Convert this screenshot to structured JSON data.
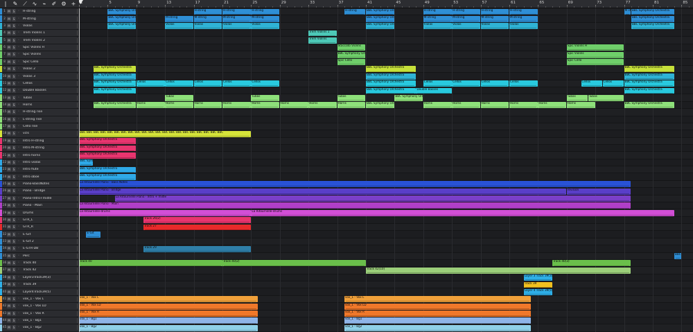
{
  "ruler": {
    "bars": [
      "1",
      "5",
      "9",
      "13",
      "17",
      "21",
      "25",
      "29",
      "33",
      "37",
      "41",
      "45",
      "49",
      "53",
      "57",
      "61",
      "65",
      "69",
      "73",
      "77",
      "81",
      "85"
    ]
  },
  "toolbar": {
    "tools": [
      {
        "name": "cursor-tool-icon",
        "glyph": "|"
      },
      {
        "name": "pencil-tool-icon",
        "glyph": "✎"
      },
      {
        "name": "automation-tool-icon",
        "glyph": "⟋"
      },
      {
        "name": "curve-tool-icon",
        "glyph": "∿"
      },
      {
        "name": "paint-tool-icon",
        "glyph": "⌁"
      },
      {
        "name": "brush-tool-icon",
        "glyph": "✐"
      },
      {
        "name": "settings-icon",
        "glyph": "⚙"
      },
      {
        "name": "add-track-icon",
        "glyph": "+"
      }
    ]
  },
  "track_buttons": {
    "mute": "M",
    "solo": "S",
    "monitor": "◦"
  },
  "tracks": [
    {
      "name": "H-string",
      "color": "#2f8fd6"
    },
    {
      "name": "M-string",
      "color": "#2f8fd6"
    },
    {
      "name": "Violas",
      "color": "#2fb3d6"
    },
    {
      "name": "Trem Violins 1",
      "color": "#4ec9b8"
    },
    {
      "name": "Trem Violins 2",
      "color": "#4ec9b8"
    },
    {
      "name": "Spic Violins H",
      "color": "#6fcf6a"
    },
    {
      "name": "Spic Violins",
      "color": "#6fcf6a"
    },
    {
      "name": "Spic Cello",
      "color": "#6fcf6a"
    },
    {
      "name": "Violas 2",
      "color": "#c6e03a"
    },
    {
      "name": "Violas 3",
      "color": "#2fb3d6"
    },
    {
      "name": "Cellos",
      "color": "#29c9de"
    },
    {
      "name": "Double Basses",
      "color": "#29c9de"
    },
    {
      "name": "Tubas",
      "color": "#8ee07a"
    },
    {
      "name": "Horns",
      "color": "#8ee07a"
    },
    {
      "name": "H-string rise",
      "color": "#8ee07a"
    },
    {
      "name": "L-string rise",
      "color": "#8ee07a"
    },
    {
      "name": "Cello rise",
      "color": "#8ee07a"
    },
    {
      "name": "vcls",
      "color": "#d6e43a"
    },
    {
      "name": "Intro H-string",
      "color": "#e8356f"
    },
    {
      "name": "Intro M-string",
      "color": "#e8356f"
    },
    {
      "name": "Intro horns",
      "color": "#e8356f"
    },
    {
      "name": "Intro violas",
      "color": "#2fa9e8"
    },
    {
      "name": "Intro flute",
      "color": "#2fa9e8"
    },
    {
      "name": "Intro oboe",
      "color": "#2fa9e8"
    },
    {
      "name": "Piano-BassNotes",
      "color": "#2952d6"
    },
    {
      "name": "Piano - Bridge",
      "color": "#5a3fc8"
    },
    {
      "name": "Piano-Intro+midle",
      "color": "#7b3fc8"
    },
    {
      "name": "Piano - Main",
      "color": "#b03fc8"
    },
    {
      "name": "Drums",
      "color": "#d24fd6"
    },
    {
      "name": "GTR_L",
      "color": "#e8356f"
    },
    {
      "name": "GTR_R",
      "color": "#e82a2a"
    },
    {
      "name": "E-Git",
      "color": "#2f8fd6"
    },
    {
      "name": "E-Git 2",
      "color": "#2f8fd6"
    },
    {
      "name": "E-GTR-DB",
      "color": "#2f8fd6"
    },
    {
      "name": "Perc",
      "color": "#2f8fd6"
    },
    {
      "name": "Track 40",
      "color": "#6abf4b"
    },
    {
      "name": "Track 42",
      "color": "#9ccf7a"
    },
    {
      "name": "Layer3Track39(3)",
      "color": "#2fb0e8"
    },
    {
      "name": "Track 39",
      "color": "#2fb0e8"
    },
    {
      "name": "Layer4Track39(5)",
      "color": "#2fb0e8"
    },
    {
      "name": "vox_1 - Vox L",
      "color": "#f0a03a"
    },
    {
      "name": "vox_1 - Vox LD",
      "color": "#f0782a"
    },
    {
      "name": "vox_1 - Vox R",
      "color": "#f0782a"
    },
    {
      "name": "vox_1 - Bg1",
      "color": "#8fb4e8"
    },
    {
      "name": "vox_1 - Bg2",
      "color": "#8fd0e8"
    }
  ],
  "clips": [
    {
      "t": 0,
      "s": 5,
      "e": 9,
      "label": "BBC Symphony Orchestra",
      "color": "#2f8fd6"
    },
    {
      "t": 0,
      "s": 17,
      "e": 21,
      "label": "H-string",
      "color": "#2f8fd6"
    },
    {
      "t": 0,
      "s": 21,
      "e": 25,
      "label": "H-string",
      "color": "#2f8fd6"
    },
    {
      "t": 0,
      "s": 25,
      "e": 29,
      "label": "H-string",
      "color": "#2f8fd6"
    },
    {
      "t": 0,
      "s": 38,
      "e": 41,
      "label": "H-string",
      "color": "#2f8fd6"
    },
    {
      "t": 0,
      "s": 41,
      "e": 45,
      "label": "BBC Symphony Orchestra",
      "color": "#2f8fd6"
    },
    {
      "t": 0,
      "s": 49,
      "e": 53,
      "label": "H-string",
      "color": "#2f8fd6"
    },
    {
      "t": 0,
      "s": 53,
      "e": 57,
      "label": "H-string",
      "color": "#2f8fd6"
    },
    {
      "t": 0,
      "s": 57,
      "e": 61,
      "label": "H-string",
      "color": "#2f8fd6"
    },
    {
      "t": 0,
      "s": 61,
      "e": 65,
      "label": "H-string",
      "color": "#2f8fd6"
    },
    {
      "t": 0,
      "s": 77,
      "e": 78,
      "label": "M str",
      "color": "#2f8fd6"
    },
    {
      "t": 0,
      "s": 78,
      "e": 84,
      "label": "BBC Symphony Orchestra",
      "color": "#2f8fd6"
    },
    {
      "t": 1,
      "s": 5,
      "e": 9,
      "label": "BBC Symphony Orchestra",
      "color": "#2f8fd6"
    },
    {
      "t": 1,
      "s": 13,
      "e": 17,
      "label": "M-string",
      "color": "#2f8fd6"
    },
    {
      "t": 1,
      "s": 17,
      "e": 21,
      "label": "M-string",
      "color": "#2f8fd6"
    },
    {
      "t": 1,
      "s": 21,
      "e": 25,
      "label": "M-string",
      "color": "#2f8fd6"
    },
    {
      "t": 1,
      "s": 25,
      "e": 29,
      "label": "M-string",
      "color": "#2f8fd6"
    },
    {
      "t": 1,
      "s": 41,
      "e": 45,
      "label": "BBC Symphony Orchestra",
      "color": "#2f8fd6"
    },
    {
      "t": 1,
      "s": 49,
      "e": 53,
      "label": "M-string",
      "color": "#2f8fd6"
    },
    {
      "t": 1,
      "s": 53,
      "e": 57,
      "label": "M-string",
      "color": "#2f8fd6"
    },
    {
      "t": 1,
      "s": 57,
      "e": 61,
      "label": "M-string",
      "color": "#2f8fd6"
    },
    {
      "t": 1,
      "s": 61,
      "e": 65,
      "label": "M-string",
      "color": "#2f8fd6"
    },
    {
      "t": 1,
      "s": 78,
      "e": 84,
      "label": "BBC Symphony Orchestra",
      "color": "#2f8fd6"
    },
    {
      "t": 2,
      "s": 5,
      "e": 9,
      "label": "BBC Symphony Orchestra",
      "color": "#2fb3d6"
    },
    {
      "t": 2,
      "s": 13,
      "e": 17,
      "label": "Violas",
      "color": "#2fb3d6"
    },
    {
      "t": 2,
      "s": 17,
      "e": 21,
      "label": "Violas",
      "color": "#2fb3d6"
    },
    {
      "t": 2,
      "s": 21,
      "e": 25,
      "label": "Violas",
      "color": "#2fb3d6"
    },
    {
      "t": 2,
      "s": 25,
      "e": 29,
      "label": "Violas",
      "color": "#2fb3d6"
    },
    {
      "t": 2,
      "s": 41,
      "e": 45,
      "label": "BBC Symphony Orchestra",
      "color": "#2fb3d6"
    },
    {
      "t": 2,
      "s": 49,
      "e": 53,
      "label": "Violas",
      "color": "#2fb3d6"
    },
    {
      "t": 2,
      "s": 53,
      "e": 57,
      "label": "Violas",
      "color": "#2fb3d6"
    },
    {
      "t": 2,
      "s": 57,
      "e": 61,
      "label": "Violas",
      "color": "#2fb3d6"
    },
    {
      "t": 2,
      "s": 61,
      "e": 65,
      "label": "Violas",
      "color": "#2fb3d6"
    },
    {
      "t": 2,
      "s": 78,
      "e": 84,
      "label": "BBC Symphony Orchestra",
      "color": "#2fb3d6"
    },
    {
      "t": 3,
      "s": 33,
      "e": 37,
      "label": "Trem Violins 1",
      "color": "#4ec9b8"
    },
    {
      "t": 4,
      "s": 33,
      "e": 37,
      "label": "Trem Violins",
      "color": "#4ec9b8"
    },
    {
      "t": 5,
      "s": 37,
      "e": 41,
      "label": "Staccato Violins",
      "color": "#6fcf6a"
    },
    {
      "t": 5,
      "s": 69,
      "e": 77,
      "label": "Spic Violins H",
      "color": "#6fcf6a"
    },
    {
      "t": 6,
      "s": 37,
      "e": 41,
      "label": "BBC Symphony Orche",
      "color": "#6fcf6a"
    },
    {
      "t": 6,
      "s": 69,
      "e": 77,
      "label": "Spic Violins",
      "color": "#6fcf6a"
    },
    {
      "t": 7,
      "s": 37,
      "e": 41,
      "label": "Spic Cello",
      "color": "#6fcf6a"
    },
    {
      "t": 7,
      "s": 69,
      "e": 77,
      "label": "Spic Cello",
      "color": "#6fcf6a"
    },
    {
      "t": 8,
      "s": 3,
      "e": 9,
      "label": "BBC Symphony Orchestra",
      "color": "#c6e03a"
    },
    {
      "t": 8,
      "s": 41,
      "e": 48,
      "label": "BBC Symphony Orchestra",
      "color": "#c6e03a"
    },
    {
      "t": 8,
      "s": 77,
      "e": 84,
      "label": "BBC Symphony Orchestra",
      "color": "#c6e03a"
    },
    {
      "t": 9,
      "s": 3,
      "e": 9,
      "label": "BBC Symphony Orchestra",
      "color": "#2fb3d6"
    },
    {
      "t": 9,
      "s": 41,
      "e": 48,
      "label": "BBC Symphony Orchestra",
      "color": "#2fb3d6"
    },
    {
      "t": 9,
      "s": 77,
      "e": 84,
      "label": "BBC Symphony Orchestra",
      "color": "#2fb3d6"
    },
    {
      "t": 10,
      "s": 3,
      "e": 9,
      "label": "BBC Symphony Orchestra",
      "color": "#29c9de"
    },
    {
      "t": 10,
      "s": 9,
      "e": 13,
      "label": "Cellos",
      "color": "#29c9de"
    },
    {
      "t": 10,
      "s": 13,
      "e": 17,
      "label": "Cellos",
      "color": "#29c9de"
    },
    {
      "t": 10,
      "s": 17,
      "e": 21,
      "label": "Cellos",
      "color": "#29c9de"
    },
    {
      "t": 10,
      "s": 21,
      "e": 25,
      "label": "Cellos",
      "color": "#29c9de"
    },
    {
      "t": 10,
      "s": 25,
      "e": 29,
      "label": "Cellos",
      "color": "#29c9de"
    },
    {
      "t": 10,
      "s": 41,
      "e": 48,
      "label": "BBC Symphony Orchestra",
      "color": "#29c9de"
    },
    {
      "t": 10,
      "s": 49,
      "e": 53,
      "label": "Cellos",
      "color": "#29c9de"
    },
    {
      "t": 10,
      "s": 53,
      "e": 57,
      "label": "Cellos",
      "color": "#29c9de"
    },
    {
      "t": 10,
      "s": 57,
      "e": 61,
      "label": "Cellos",
      "color": "#29c9de"
    },
    {
      "t": 10,
      "s": 61,
      "e": 65,
      "label": "Cellos",
      "color": "#29c9de"
    },
    {
      "t": 10,
      "s": 71,
      "e": 74,
      "label": "Cellos",
      "color": "#29c9de"
    },
    {
      "t": 10,
      "s": 74,
      "e": 77,
      "label": "Cellos",
      "color": "#29c9de"
    },
    {
      "t": 10,
      "s": 77,
      "e": 84,
      "label": "BBC Symphony Orchestra",
      "color": "#29c9de"
    },
    {
      "t": 11,
      "s": 3,
      "e": 9,
      "label": "BBC Symphony Orchestra",
      "color": "#29c9de"
    },
    {
      "t": 11,
      "s": 41,
      "e": 48,
      "label": "BBC Symphony Orchestra",
      "color": "#29c9de"
    },
    {
      "t": 11,
      "s": 48,
      "e": 53,
      "label": "Double Basses",
      "color": "#29c9de"
    },
    {
      "t": 11,
      "s": 77,
      "e": 84,
      "label": "BBC Symphony Orchestra",
      "color": "#29c9de"
    },
    {
      "t": 12,
      "s": 13,
      "e": 17,
      "label": "Tubas",
      "color": "#8ee07a"
    },
    {
      "t": 12,
      "s": 25,
      "e": 29,
      "label": "Tubas",
      "color": "#8ee07a"
    },
    {
      "t": 12,
      "s": 37,
      "e": 41,
      "label": "Tubas",
      "color": "#8ee07a"
    },
    {
      "t": 12,
      "s": 45,
      "e": 49,
      "label": "BBC Symphony Orchestra",
      "color": "#8ee07a"
    },
    {
      "t": 12,
      "s": 69,
      "e": 72,
      "label": "Tubas",
      "color": "#8ee07a"
    },
    {
      "t": 12,
      "s": 72,
      "e": 77,
      "label": "Tubas",
      "color": "#8ee07a"
    },
    {
      "t": 13,
      "s": 3,
      "e": 9,
      "label": "BBC Symphony Orchestra",
      "color": "#8ee07a"
    },
    {
      "t": 13,
      "s": 9,
      "e": 13,
      "label": "Horns",
      "color": "#8ee07a"
    },
    {
      "t": 13,
      "s": 13,
      "e": 17,
      "label": "Horns",
      "color": "#8ee07a"
    },
    {
      "t": 13,
      "s": 17,
      "e": 21,
      "label": "Horns",
      "color": "#8ee07a"
    },
    {
      "t": 13,
      "s": 21,
      "e": 25,
      "label": "Horns",
      "color": "#8ee07a"
    },
    {
      "t": 13,
      "s": 25,
      "e": 29,
      "label": "Horns",
      "color": "#8ee07a"
    },
    {
      "t": 13,
      "s": 29,
      "e": 33,
      "label": "Horns",
      "color": "#8ee07a"
    },
    {
      "t": 13,
      "s": 33,
      "e": 37,
      "label": "Horns",
      "color": "#8ee07a"
    },
    {
      "t": 13,
      "s": 37,
      "e": 41,
      "label": "Horns",
      "color": "#8ee07a"
    },
    {
      "t": 13,
      "s": 41,
      "e": 45,
      "label": "BBC Symphony Orchestra",
      "color": "#8ee07a"
    },
    {
      "t": 13,
      "s": 49,
      "e": 53,
      "label": "Horns",
      "color": "#8ee07a"
    },
    {
      "t": 13,
      "s": 53,
      "e": 57,
      "label": "Horns",
      "color": "#8ee07a"
    },
    {
      "t": 13,
      "s": 57,
      "e": 61,
      "label": "Horns",
      "color": "#8ee07a"
    },
    {
      "t": 13,
      "s": 61,
      "e": 65,
      "label": "Horns",
      "color": "#8ee07a"
    },
    {
      "t": 13,
      "s": 65,
      "e": 69,
      "label": "Horns",
      "color": "#8ee07a"
    },
    {
      "t": 13,
      "s": 69,
      "e": 73,
      "label": "Horns",
      "color": "#8ee07a"
    },
    {
      "t": 13,
      "s": 77,
      "e": 84,
      "label": "BBC Symphony Orchestra",
      "color": "#8ee07a"
    },
    {
      "t": 17,
      "s": 1,
      "e": 25,
      "label": "BBC BBC BBC BBC BBC BBC BBC BBC BBC BBC BBC BBC BBC BBC BBC BBC BBC BBC BBC BBC BBC",
      "color": "#d6e43a"
    },
    {
      "t": 18,
      "s": 1,
      "e": 9,
      "label": "BBC Symphony Orchestra",
      "color": "#e8356f"
    },
    {
      "t": 19,
      "s": 1,
      "e": 9,
      "label": "BBC Symphony Orchestra",
      "color": "#e8356f"
    },
    {
      "t": 20,
      "s": 1,
      "e": 9,
      "label": "BBC Symphony Orchestra",
      "color": "#e8356f"
    },
    {
      "t": 21,
      "s": 1,
      "e": 3,
      "label": "BBC Sym",
      "color": "#2fa9e8"
    },
    {
      "t": 22,
      "s": 1,
      "e": 9,
      "label": "BBC Symphony Orchestra",
      "color": "#2fa9e8"
    },
    {
      "t": 23,
      "s": 1,
      "e": 9,
      "label": "BBC Symphony Orchestra",
      "color": "#2fa9e8"
    },
    {
      "t": 24,
      "s": 1,
      "e": 78,
      "label": "La Ritournelle Piano - Bass Notes",
      "color": "#2952d6"
    },
    {
      "t": 25,
      "s": 1,
      "e": 69,
      "label": "La Ritournelle Piano - Bridge",
      "color": "#5a3fc8"
    },
    {
      "t": 25,
      "s": 69,
      "e": 78,
      "label": "revision",
      "color": "#5a3fc8"
    },
    {
      "t": 26,
      "s": 6,
      "e": 78,
      "label": "La Ritournelle Piano - Intro + midle",
      "color": "#7b3fc8"
    },
    {
      "t": 27,
      "s": 1,
      "e": 78,
      "label": "La Ritournelle Piano - Main",
      "color": "#b03fc8"
    },
    {
      "t": 28,
      "s": 1,
      "e": 25,
      "label": "La Ritournelle-drums",
      "color": "#d24fd6"
    },
    {
      "t": 28,
      "s": 25,
      "e": 84,
      "label": "La Ritournelle-drums",
      "color": "#d24fd6"
    },
    {
      "t": 29,
      "s": 10,
      "e": 25,
      "label": "Track 26(2)",
      "color": "#e8356f"
    },
    {
      "t": 30,
      "s": 10,
      "e": 25,
      "label": "Track 27",
      "color": "#e82a2a"
    },
    {
      "t": 31,
      "s": 2,
      "e": 4,
      "label": "E-Git",
      "color": "#2f8fd6"
    },
    {
      "t": 33,
      "s": 10,
      "e": 25,
      "label": "Track 29",
      "color": "#2f7fa8"
    },
    {
      "t": 34,
      "s": 84,
      "e": 85,
      "label": "BBC",
      "color": "#2f8fd6"
    },
    {
      "t": 35,
      "s": 1,
      "e": 21,
      "label": "Track 40",
      "color": "#6abf4b"
    },
    {
      "t": 35,
      "s": 21,
      "e": 41,
      "label": "Track 40(2)",
      "color": "#6abf4b"
    },
    {
      "t": 35,
      "s": 67,
      "e": 78,
      "label": "Track 40(3)",
      "color": "#6abf4b"
    },
    {
      "t": 36,
      "s": 41,
      "e": 78,
      "label": "Track 42(10)",
      "color": "#9ccf7a"
    },
    {
      "t": 37,
      "s": 63,
      "e": 67,
      "label": "Layer 3 Track 39(3)",
      "color": "#2fb0e8"
    },
    {
      "t": 38,
      "s": 63,
      "e": 67,
      "label": "Track 39",
      "color": "#f0c020"
    },
    {
      "t": 39,
      "s": 63,
      "e": 67,
      "label": "Layer 4 Track 39(5)",
      "color": "#2fb0e8"
    },
    {
      "t": 40,
      "s": 1,
      "e": 26,
      "label": "vox_1 - Vox L",
      "color": "#f0a03a"
    },
    {
      "t": 40,
      "s": 38,
      "e": 64,
      "label": "vox_1 - Vox L",
      "color": "#f0a03a"
    },
    {
      "t": 41,
      "s": 1,
      "e": 26,
      "label": "vox_1 - Vox LD",
      "color": "#f0782a"
    },
    {
      "t": 41,
      "s": 38,
      "e": 64,
      "label": "vox_1 - Vox LD",
      "color": "#f0782a"
    },
    {
      "t": 42,
      "s": 1,
      "e": 26,
      "label": "vox_1 - Vox R",
      "color": "#f0782a"
    },
    {
      "t": 42,
      "s": 38,
      "e": 64,
      "label": "vox_1 - Vox R",
      "color": "#f0782a"
    },
    {
      "t": 43,
      "s": 1,
      "e": 26,
      "label": "vox_1 - Bg1",
      "color": "#8fb4e8"
    },
    {
      "t": 43,
      "s": 38,
      "e": 64,
      "label": "vox_1 - Bg1",
      "color": "#8fb4e8"
    },
    {
      "t": 44,
      "s": 1,
      "e": 26,
      "label": "vox_1 - Bg2",
      "color": "#8fd0e8"
    },
    {
      "t": 44,
      "s": 38,
      "e": 64,
      "label": "vox_1 - Bg2",
      "color": "#8fd0e8"
    }
  ]
}
